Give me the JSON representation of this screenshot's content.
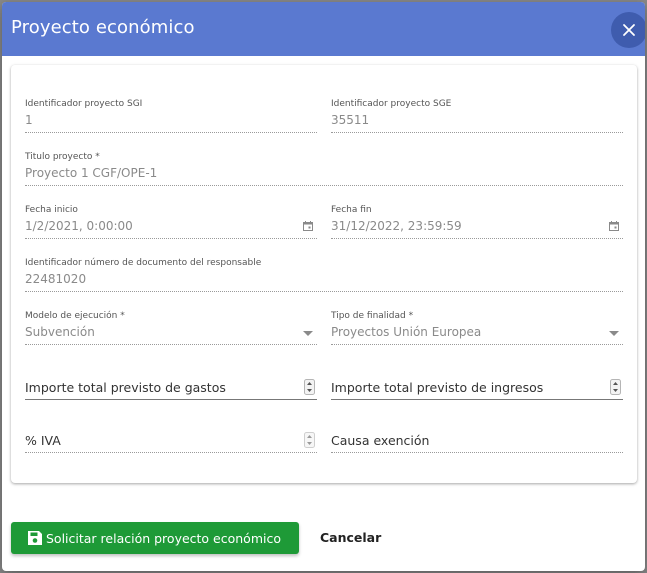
{
  "dialog": {
    "title": "Proyecto económico",
    "close_icon": "close-icon"
  },
  "form": {
    "id_sgi": {
      "label": "Identificador proyecto SGI",
      "value": "1"
    },
    "id_sge": {
      "label": "Identificador proyecto SGE",
      "value": "35511"
    },
    "titulo": {
      "label": "Titulo proyecto *",
      "value": "Proyecto 1 CGF/OPE-1"
    },
    "fecha_inicio": {
      "label": "Fecha inicio",
      "value": "1/2/2021, 0:00:00",
      "icon": "calendar-icon"
    },
    "fecha_fin": {
      "label": "Fecha fin",
      "value": "31/12/2022, 23:59:59",
      "icon": "calendar-icon"
    },
    "responsable": {
      "label": "Identificador número de documento del responsable",
      "value": "22481020"
    },
    "modelo": {
      "label": "Modelo de ejecución *",
      "value": "Subvención",
      "icon": "dropdown-arrow-icon"
    },
    "finalidad": {
      "label": "Tipo de finalidad *",
      "value": "Proyectos Unión Europea",
      "icon": "dropdown-arrow-icon"
    },
    "importe_gastos": {
      "placeholder": "Importe total previsto de gastos"
    },
    "importe_ingresos": {
      "placeholder": "Importe total previsto de ingresos"
    },
    "iva": {
      "placeholder": "% IVA"
    },
    "causa": {
      "placeholder": "Causa exención"
    }
  },
  "actions": {
    "submit_label": "Solicitar relación proyecto económico",
    "submit_icon": "save-icon",
    "cancel_label": "Cancelar"
  },
  "colors": {
    "header": "#5a79d0",
    "submit": "#1e9a37"
  }
}
